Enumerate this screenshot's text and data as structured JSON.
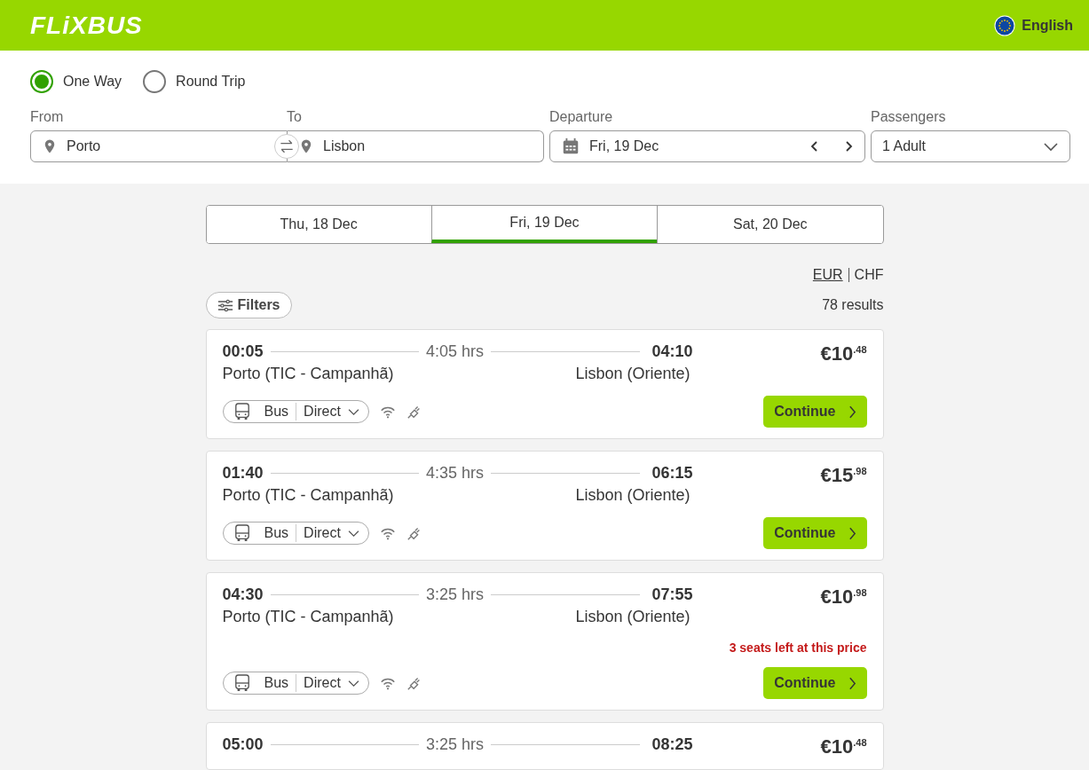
{
  "header": {
    "logo": "FLiXBUS",
    "language": "English"
  },
  "trip_type": [
    {
      "label": "One Way",
      "selected": true
    },
    {
      "label": "Round Trip",
      "selected": false
    }
  ],
  "search": {
    "from": {
      "label": "From",
      "value": "Porto"
    },
    "to": {
      "label": "To",
      "value": "Lisbon"
    },
    "departure": {
      "label": "Departure",
      "value": "Fri, 19 Dec"
    },
    "passengers": {
      "label": "Passengers",
      "value": "1 Adult"
    }
  },
  "date_tabs": [
    {
      "label": "Thu, 18 Dec",
      "selected": false
    },
    {
      "label": "Fri, 19 Dec",
      "selected": true
    },
    {
      "label": "Sat, 20 Dec",
      "selected": false
    }
  ],
  "currencies": [
    {
      "label": "EUR",
      "selected": true
    },
    {
      "label": "CHF",
      "selected": false
    }
  ],
  "filters_button": "Filters",
  "results_count": "78 results",
  "trips": [
    {
      "departure_time": "00:05",
      "duration": "4:05 hrs",
      "arrival_time": "04:10",
      "from_station": "Porto (TIC - Campanhã)",
      "to_station": "Lisbon (Oriente)",
      "price": "€10$^{.48}$",
      "mode": "Bus",
      "transfer": "Direct",
      "button": "Continue"
    },
    {
      "departure_time": "01:40",
      "duration": "4:35 hrs",
      "arrival_time": "06:15",
      "from_station": "Porto (TIC - Campanhã)",
      "to_station": "Lisbon (Oriente)",
      "price": "€15$^{.98}$",
      "mode": "Bus",
      "transfer": "Direct",
      "button": "Continue"
    },
    {
      "departure_time": "04:30",
      "duration": "3:25 hrs",
      "arrival_time": "07:55",
      "from_station": "Porto (TIC - Campanhã)",
      "to_station": "Lisbon (Oriente)",
      "price": "€10$^{.98}$",
      "warning": "3 seats left at this price",
      "mode": "Bus",
      "transfer": "Direct",
      "button": "Continue"
    },
    {
      "departure_time": "05:00",
      "duration": "3:25 hrs",
      "arrival_time": "08:25",
      "price": "€10$^{.48}$"
    }
  ]
}
